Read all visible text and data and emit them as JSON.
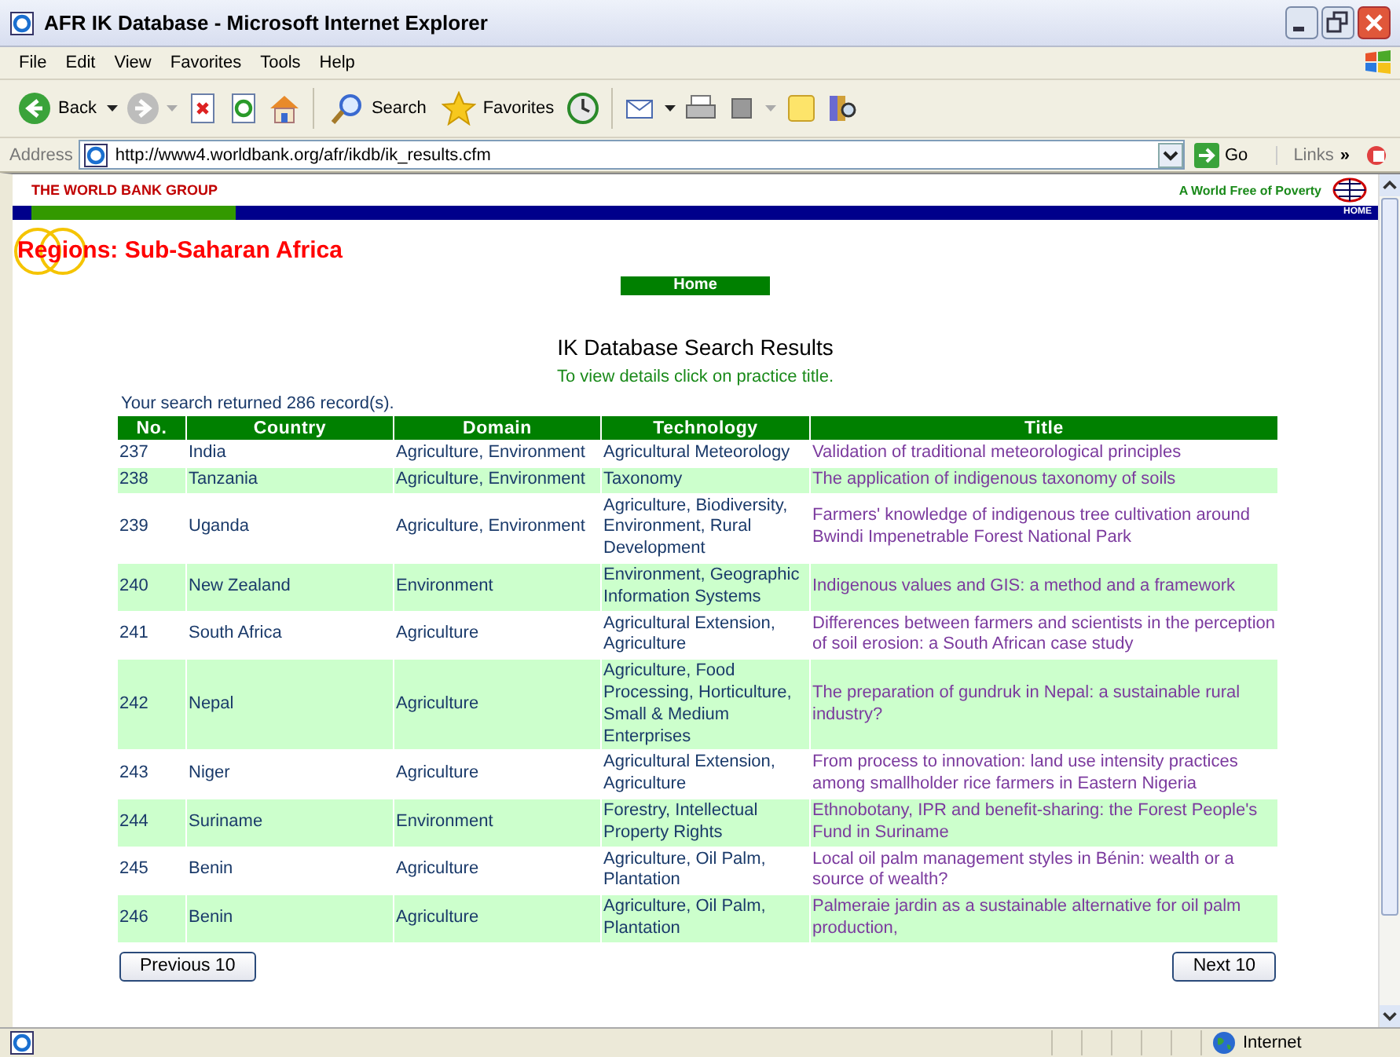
{
  "window": {
    "title": "AFR IK Database - Microsoft Internet Explorer"
  },
  "menu": [
    "File",
    "Edit",
    "View",
    "Favorites",
    "Tools",
    "Help"
  ],
  "toolbar": {
    "back": "Back",
    "search": "Search",
    "favorites": "Favorites"
  },
  "address": {
    "label": "Address",
    "url": "http://www4.worldbank.org/afr/ikdb/ik_results.cfm",
    "go": "Go",
    "links": "Links",
    "links_chevron": "»"
  },
  "site_header": {
    "brand": "THE WORLD BANK GROUP",
    "tagline": "A World Free of Poverty",
    "home_link": "HOME"
  },
  "region_title": "Regions: Sub-Saharan Africa",
  "home_button": "Home",
  "heading": "IK Database Search Results",
  "hint": "To view details click on practice title.",
  "result_count": "Your search returned 286 record(s).",
  "table": {
    "columns": [
      "No.",
      "Country",
      "Domain",
      "Technology",
      "Title"
    ],
    "rows": [
      {
        "no": "237",
        "country": "India",
        "domain": "Agriculture, Environment",
        "technology": "Agricultural Meteorology",
        "title": "Validation of traditional meteorological principles"
      },
      {
        "no": "238",
        "country": "Tanzania",
        "domain": "Agriculture, Environment",
        "technology": "Taxonomy",
        "title": "The application of indigenous taxonomy of soils"
      },
      {
        "no": "239",
        "country": "Uganda",
        "domain": "Agriculture, Environment",
        "technology": "Agriculture, Biodiversity, Environment, Rural Development",
        "title": "Farmers' knowledge of indigenous tree cultivation around Bwindi Impenetrable Forest National Park"
      },
      {
        "no": "240",
        "country": "New Zealand",
        "domain": "Environment",
        "technology": "Environment, Geographic Information Systems",
        "title": "Indigenous values and GIS: a method and a framework"
      },
      {
        "no": "241",
        "country": "South Africa",
        "domain": "Agriculture",
        "technology": "Agricultural Extension, Agriculture",
        "title": "Differences between farmers and scientists in the perception of soil erosion: a South African case study"
      },
      {
        "no": "242",
        "country": "Nepal",
        "domain": "Agriculture",
        "technology": "Agriculture, Food Processing, Horticulture, Small & Medium Enterprises",
        "title": "The preparation of gundruk in Nepal: a sustainable rural industry?"
      },
      {
        "no": "243",
        "country": "Niger",
        "domain": "Agriculture",
        "technology": "Agricultural Extension, Agriculture",
        "title": "From process to innovation: land use intensity practices among smallholder rice farmers in Eastern Nigeria"
      },
      {
        "no": "244",
        "country": "Suriname",
        "domain": "Environment",
        "technology": "Forestry, Intellectual Property Rights",
        "title": "Ethnobotany, IPR and benefit-sharing: the Forest People's Fund in Suriname"
      },
      {
        "no": "245",
        "country": "Benin",
        "domain": "Agriculture",
        "technology": "Agriculture, Oil Palm, Plantation",
        "title": "Local oil palm management styles in Bénin: wealth or a source of wealth?"
      },
      {
        "no": "246",
        "country": "Benin",
        "domain": "Agriculture",
        "technology": "Agriculture, Oil Palm, Plantation",
        "title": "Palmeraie jardin as a sustainable alternative for oil palm production,"
      }
    ]
  },
  "pager": {
    "previous": "Previous 10",
    "next": "Next 10"
  },
  "status_bar": {
    "zone": "Internet"
  }
}
